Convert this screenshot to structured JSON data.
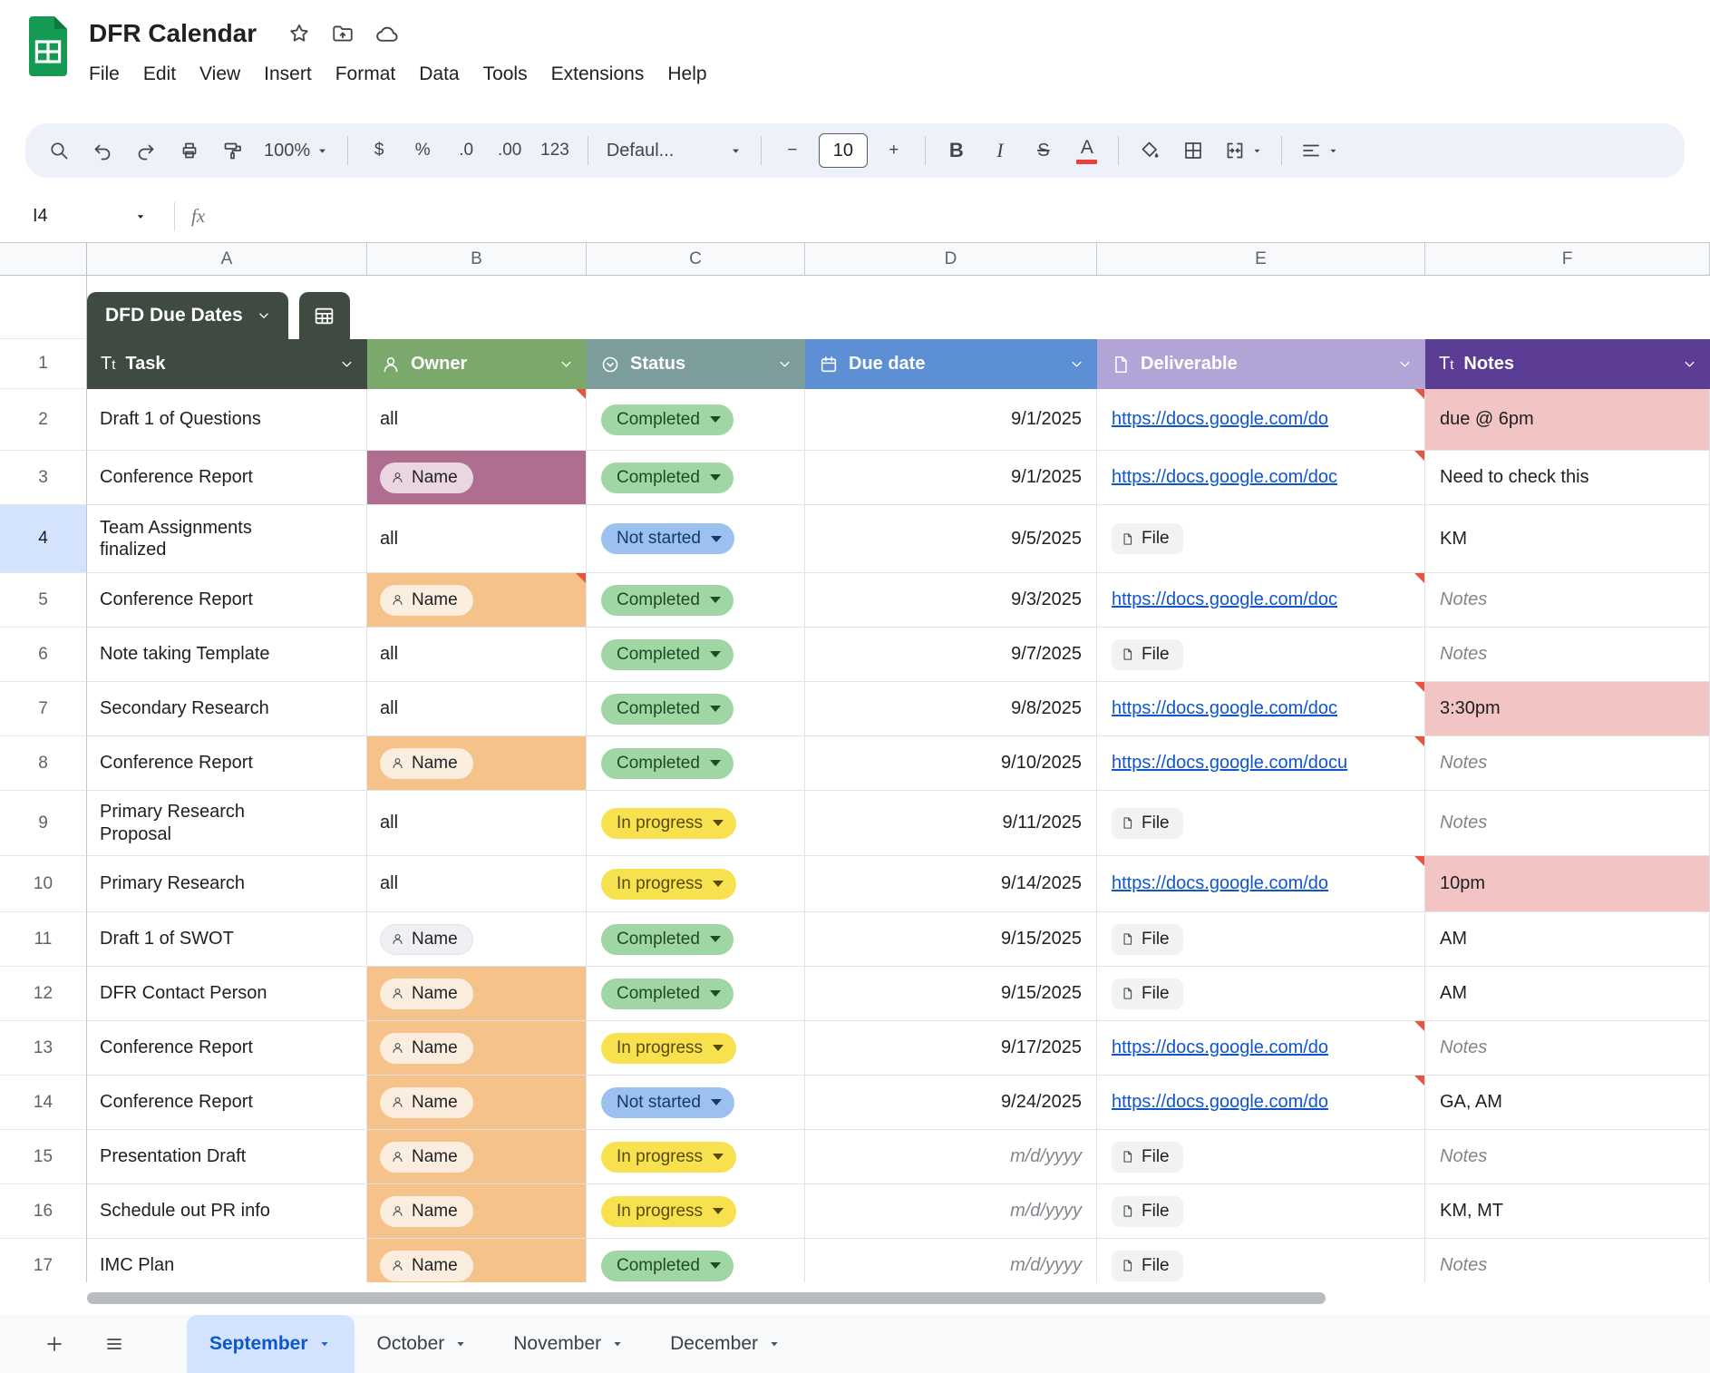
{
  "header": {
    "title": "DFR Calendar",
    "menus": [
      "File",
      "Edit",
      "View",
      "Insert",
      "Format",
      "Data",
      "Tools",
      "Extensions",
      "Help"
    ]
  },
  "toolbar": {
    "zoom": "100%",
    "currency": "$",
    "percent": "%",
    "decrease_decimal": ".0",
    "increase_decimal": ".00",
    "plain_format": "123",
    "font_name": "Defaul...",
    "font_size": "10",
    "minus": "−",
    "plus": "+",
    "bold": "B",
    "italic": "I",
    "strikethrough": "S",
    "text_color": "A"
  },
  "formula_bar": {
    "cell_ref": "I4",
    "fx_label": "fx"
  },
  "grid": {
    "column_letters": [
      "A",
      "B",
      "C",
      "D",
      "E",
      "F"
    ],
    "row_numbers": [
      "1",
      "2",
      "3",
      "4",
      "5",
      "6",
      "7",
      "8",
      "9",
      "10",
      "11",
      "12",
      "13",
      "14",
      "15",
      "16",
      "17"
    ],
    "selected_row": "4"
  },
  "table": {
    "name": "DFD Due Dates",
    "columns": [
      {
        "label": "Task",
        "icon": "text-format-icon",
        "bg": "#3f4a40"
      },
      {
        "label": "Owner",
        "icon": "person-icon",
        "bg": "#7aa96b"
      },
      {
        "label": "Status",
        "icon": "dropdown-circle-icon",
        "bg": "#7d9d9c"
      },
      {
        "label": "Due date",
        "icon": "calendar-icon",
        "bg": "#5d8fd5"
      },
      {
        "label": "Deliverable",
        "icon": "file-icon",
        "bg": "#b2a4d6"
      },
      {
        "label": "Notes",
        "icon": "text-format-icon",
        "bg": "#5b3d96"
      }
    ],
    "rows": [
      {
        "n": "2",
        "task": "Draft 1 of Questions",
        "owner": {
          "type": "text",
          "value": "all",
          "note": true
        },
        "status": "Completed",
        "due": "9/1/2025",
        "deliverable": {
          "type": "link",
          "value": "https://docs.google.com/do",
          "note": true
        },
        "notes": {
          "value": "due @ 6pm",
          "bg": "pink"
        }
      },
      {
        "n": "3",
        "task": "Conference Report",
        "owner": {
          "type": "chip",
          "value": "Name",
          "cell": "mauve"
        },
        "status": "Completed",
        "due": "9/1/2025",
        "deliverable": {
          "type": "link",
          "value": "https://docs.google.com/doc",
          "note": true
        },
        "notes": {
          "value": "Need to check this"
        }
      },
      {
        "n": "4",
        "task": "Team Assignments finalized",
        "owner": {
          "type": "text",
          "value": "all"
        },
        "status": "Not started",
        "due": "9/5/2025",
        "deliverable": {
          "type": "file",
          "value": "File"
        },
        "notes": {
          "value": "KM"
        }
      },
      {
        "n": "5",
        "task": "Conference Report",
        "owner": {
          "type": "chip",
          "value": "Name",
          "cell": "orange",
          "note": true
        },
        "status": "Completed",
        "due": "9/3/2025",
        "deliverable": {
          "type": "link",
          "value": "https://docs.google.com/doc",
          "note": true
        },
        "notes": {
          "value": "Notes",
          "placeholder": true
        }
      },
      {
        "n": "6",
        "task": "Note taking Template",
        "owner": {
          "type": "text",
          "value": "all"
        },
        "status": "Completed",
        "due": "9/7/2025",
        "deliverable": {
          "type": "file",
          "value": "File"
        },
        "notes": {
          "value": "Notes",
          "placeholder": true
        }
      },
      {
        "n": "7",
        "task": "Secondary Research",
        "owner": {
          "type": "text",
          "value": "all"
        },
        "status": "Completed",
        "due": "9/8/2025",
        "deliverable": {
          "type": "link",
          "value": "https://docs.google.com/doc",
          "note": true
        },
        "notes": {
          "value": "3:30pm",
          "bg": "pink"
        }
      },
      {
        "n": "8",
        "task": "Conference Report",
        "owner": {
          "type": "chip",
          "value": "Name",
          "cell": "orange"
        },
        "status": "Completed",
        "due": "9/10/2025",
        "deliverable": {
          "type": "link",
          "value": "https://docs.google.com/docu",
          "note": true
        },
        "notes": {
          "value": "Notes",
          "placeholder": true
        }
      },
      {
        "n": "9",
        "task": "Primary Research Proposal",
        "owner": {
          "type": "text",
          "value": "all"
        },
        "status": "In progress",
        "due": "9/11/2025",
        "deliverable": {
          "type": "file",
          "value": "File"
        },
        "notes": {
          "value": "Notes",
          "placeholder": true
        }
      },
      {
        "n": "10",
        "task": "Primary Research",
        "owner": {
          "type": "text",
          "value": "all"
        },
        "status": "In progress",
        "due": "9/14/2025",
        "deliverable": {
          "type": "link",
          "value": "https://docs.google.com/do",
          "note": true
        },
        "notes": {
          "value": "10pm",
          "bg": "pink"
        }
      },
      {
        "n": "11",
        "task": "Draft 1 of SWOT",
        "owner": {
          "type": "chip",
          "value": "Name"
        },
        "status": "Completed",
        "due": "9/15/2025",
        "deliverable": {
          "type": "file",
          "value": "File"
        },
        "notes": {
          "value": "AM"
        }
      },
      {
        "n": "12",
        "task": "DFR Contact Person",
        "owner": {
          "type": "chip",
          "value": "Name",
          "cell": "orange"
        },
        "status": "Completed",
        "due": "9/15/2025",
        "deliverable": {
          "type": "file",
          "value": "File"
        },
        "notes": {
          "value": "AM"
        }
      },
      {
        "n": "13",
        "task": "Conference Report",
        "owner": {
          "type": "chip",
          "value": "Name",
          "cell": "orange"
        },
        "status": "In progress",
        "due": "9/17/2025",
        "deliverable": {
          "type": "link",
          "value": "https://docs.google.com/do",
          "note": true
        },
        "notes": {
          "value": "Notes",
          "placeholder": true
        }
      },
      {
        "n": "14",
        "task": "Conference Report",
        "owner": {
          "type": "chip",
          "value": "Name",
          "cell": "orange"
        },
        "status": "Not started",
        "due": "9/24/2025",
        "deliverable": {
          "type": "link",
          "value": "https://docs.google.com/do",
          "note": true
        },
        "notes": {
          "value": "GA, AM"
        }
      },
      {
        "n": "15",
        "task": "Presentation Draft",
        "owner": {
          "type": "chip",
          "value": "Name",
          "cell": "orange"
        },
        "status": "In progress",
        "due": "m/d/yyyy",
        "due_placeholder": true,
        "deliverable": {
          "type": "file",
          "value": "File"
        },
        "notes": {
          "value": "Notes",
          "placeholder": true
        }
      },
      {
        "n": "16",
        "task": "Schedule out PR info",
        "owner": {
          "type": "chip",
          "value": "Name",
          "cell": "orange"
        },
        "status": "In progress",
        "due": "m/d/yyyy",
        "due_placeholder": true,
        "deliverable": {
          "type": "file",
          "value": "File"
        },
        "notes": {
          "value": "KM, MT"
        }
      },
      {
        "n": "17",
        "task": "IMC Plan",
        "owner": {
          "type": "chip",
          "value": "Name",
          "cell": "orange"
        },
        "status": "Completed",
        "due": "m/d/yyyy",
        "due_placeholder": true,
        "deliverable": {
          "type": "file",
          "value": "File"
        },
        "notes": {
          "value": "Notes",
          "placeholder": true
        }
      }
    ]
  },
  "status_styles": {
    "Completed": {
      "bg": "#9fd6a4",
      "fg": "#1d4b22"
    },
    "Not started": {
      "bg": "#9cc0f0",
      "fg": "#0f3a6d"
    },
    "In progress": {
      "bg": "#f8e14e",
      "fg": "#574a08"
    }
  },
  "cell_colors": {
    "orange": "#f5c389",
    "mauve": "#af6d8f",
    "pink": "#f2c4c4",
    "note_triangle": "#e8553c",
    "link": "#1155cc",
    "active_tab_bg": "#d3e3fd",
    "active_tab_fg": "#0b57d0"
  },
  "sheet_tabs": [
    {
      "label": "September",
      "active": true
    },
    {
      "label": "October",
      "active": false
    },
    {
      "label": "November",
      "active": false
    },
    {
      "label": "December",
      "active": false
    }
  ]
}
